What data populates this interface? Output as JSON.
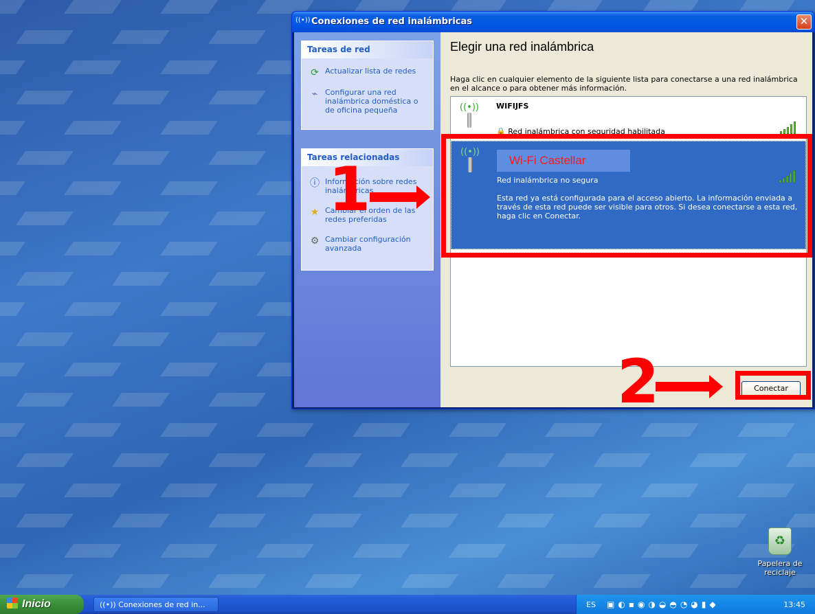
{
  "window": {
    "title": "Conexiones de red inalámbricas",
    "title_icon": "wireless-icon",
    "close_label": "✕"
  },
  "sidebar": {
    "network_tasks": {
      "header": "Tareas de red",
      "items": [
        {
          "label": "Actualizar lista de redes",
          "icon": "refresh-icon"
        },
        {
          "label": "Configurar una red inalámbrica doméstica o de oficina pequeña",
          "icon": "wizard-icon"
        }
      ]
    },
    "related_tasks": {
      "header": "Tareas relacionadas",
      "items": [
        {
          "label": "Información sobre redes inalámbricas",
          "icon": "info-icon"
        },
        {
          "label": "Cambiar el orden de las redes preferidas",
          "icon": "star-icon"
        },
        {
          "label": "Cambiar configuración avanzada",
          "icon": "settings-icon"
        }
      ]
    }
  },
  "main": {
    "heading": "Elegir una red inalámbrica",
    "description": "Haga clic en cualquier elemento de la siguiente lista para conectarse a una red inalámbrica en el alcance o para obtener más información.",
    "networks": [
      {
        "name": "WIFIJFS",
        "status": "Red inalámbrica con seguridad habilitada",
        "secured": true,
        "signal_bars": 5
      },
      {
        "name": "Wi-Fi Castellar",
        "status": "Red inalámbrica no segura",
        "detail": "Esta red ya está configurada para el acceso abierto. La información enviada a través de esta red puede ser visible para otros. Si desea conectarse a esta red, haga clic en Conectar.",
        "selected": true,
        "signal_bars": 5
      }
    ],
    "connect_label": "Conectar"
  },
  "annotations": {
    "step1": "1",
    "step2": "2",
    "ssid_overlay": "Wi-Fi Castellar"
  },
  "desktop": {
    "recycle_bin_label": "Papelera de reciclaje"
  },
  "taskbar": {
    "start_label": "Inicio",
    "task_label": "Conexiones de red in...",
    "language": "ES",
    "clock": "13:45"
  }
}
